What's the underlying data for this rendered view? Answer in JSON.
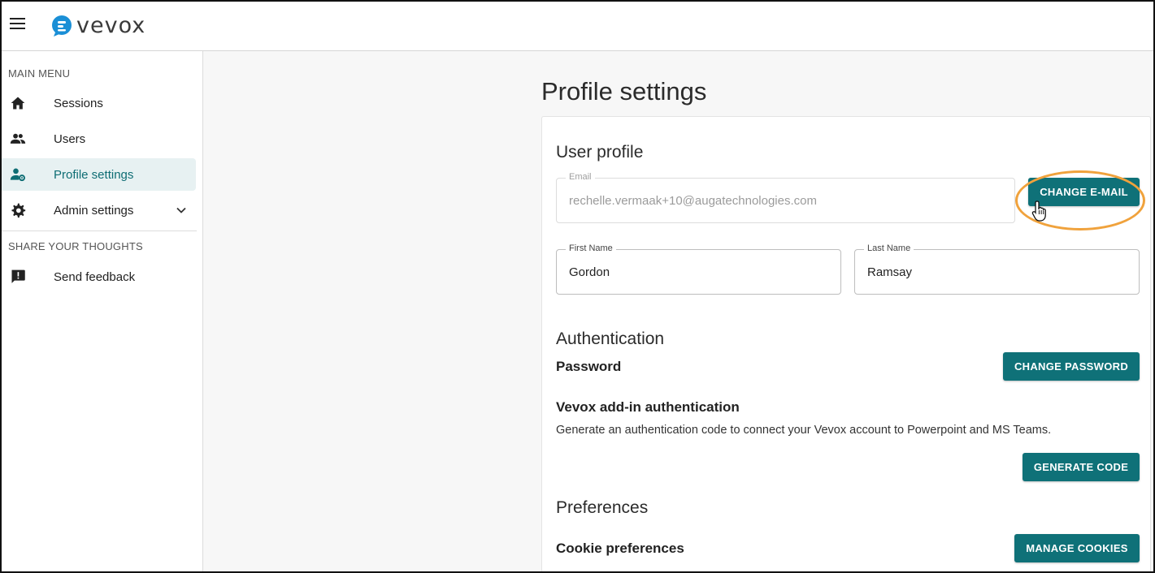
{
  "app": {
    "brand_name": "vevox",
    "brand_color": "#0f7178",
    "accent_highlight": "#f0a23c"
  },
  "sidebar": {
    "main_menu_title": "MAIN MENU",
    "items": [
      {
        "label": "Sessions",
        "icon": "home-icon",
        "active": false
      },
      {
        "label": "Users",
        "icon": "users-icon",
        "active": false
      },
      {
        "label": "Profile settings",
        "icon": "profile-settings-icon",
        "active": true
      },
      {
        "label": "Admin settings",
        "icon": "gear-icon",
        "active": false,
        "expandable": true
      }
    ],
    "share_title": "SHARE YOUR THOUGHTS",
    "feedback_label": "Send feedback"
  },
  "main": {
    "page_title": "Profile settings",
    "user_profile": {
      "heading": "User profile",
      "email_label": "Email",
      "email_value": "rechelle.vermaak+10@augatechnologies.com",
      "change_email_label": "CHANGE E-MAIL",
      "first_name_label": "First Name",
      "first_name_value": "Gordon",
      "last_name_label": "Last Name",
      "last_name_value": "Ramsay"
    },
    "authentication": {
      "heading": "Authentication",
      "password_label": "Password",
      "change_password_label": "CHANGE PASSWORD",
      "addin_heading": "Vevox add-in authentication",
      "addin_description": "Generate an authentication code to connect your Vevox account to Powerpoint and MS Teams.",
      "generate_code_label": "GENERATE CODE"
    },
    "preferences": {
      "heading": "Preferences",
      "cookie_label": "Cookie preferences",
      "manage_cookies_label": "MANAGE COOKIES"
    }
  }
}
